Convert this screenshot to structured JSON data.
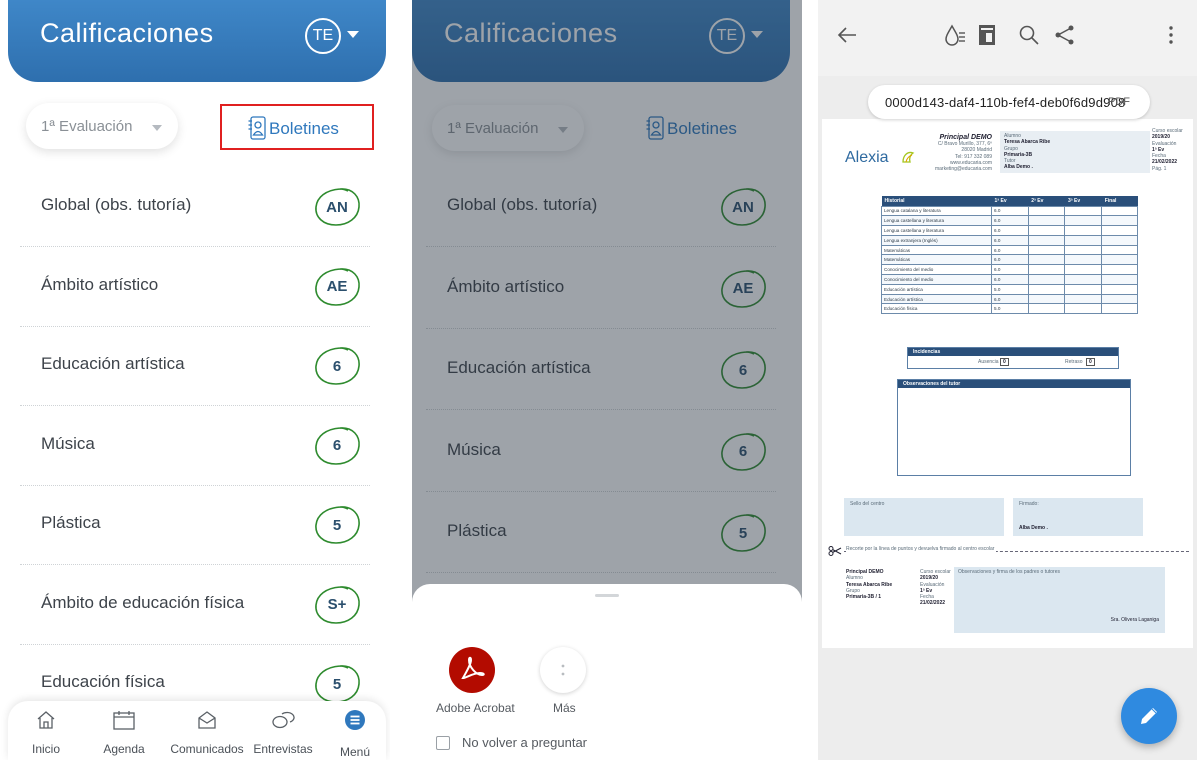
{
  "app": {
    "title": "Calificaciones",
    "avatar_initials": "TE",
    "evaluation": "1ª Evaluación",
    "boletines_label": "Boletines"
  },
  "grades": [
    {
      "subject": "Global (obs. tutoría)",
      "grade": "AN"
    },
    {
      "subject": "Ámbito artístico",
      "grade": "AE"
    },
    {
      "subject": "Educación artística",
      "grade": "6"
    },
    {
      "subject": "Música",
      "grade": "6"
    },
    {
      "subject": "Plástica",
      "grade": "5"
    },
    {
      "subject": "Ámbito de educación física",
      "grade": "S+"
    },
    {
      "subject": "Educación física",
      "grade": "5"
    }
  ],
  "bottom_nav": [
    "Inicio",
    "Agenda",
    "Comunicados",
    "Entrevistas",
    "Menú"
  ],
  "share_sheet": {
    "apps": [
      "Adobe Acrobat",
      "Más"
    ],
    "checkbox_label": "No volver a preguntar"
  },
  "pdf_viewer": {
    "file_name": "0000d143-daf4-110b-fef4-deb0f6d9d908",
    "file_ext": "PDF",
    "brand": "Alexia",
    "school": {
      "name": "Principal DEMO",
      "address": "C/ Bravo Murillo, 377, 6º",
      "city": "28020 Madrid",
      "tel": "Tel: 917 332 089",
      "web": "www.educaria.com",
      "email": "marketing@educaria.com"
    },
    "meta_labels": [
      "Alumno",
      "Grupo",
      "Tutor"
    ],
    "meta_values": [
      "Teresa Abarca Ribe",
      "Primaria-3B",
      "Alba Demo ."
    ],
    "course_labels": [
      "Curso escolar",
      "Evaluación",
      "Fecha"
    ],
    "course_values": [
      "2019/20",
      "1ª Ev",
      "21/02/2022"
    ],
    "page": "Pág. 1",
    "history_headers": [
      "Historial",
      "1ª Ev",
      "2ª Ev",
      "3ª Ev",
      "Final"
    ],
    "history_rows": [
      [
        "Lengua catalana y literatura",
        "6.0"
      ],
      [
        "Lengua castellana y literatura",
        "6.0"
      ],
      [
        "Lengua castellana y literatura",
        "6.0"
      ],
      [
        "Lengua extranjera (Inglés)",
        "6.0"
      ],
      [
        "Matemáticas",
        "6.0"
      ],
      [
        "Matemáticas",
        "6.0"
      ],
      [
        "Conocimiento del medio",
        "6.0"
      ],
      [
        "Conocimiento del medio",
        "6.0"
      ],
      [
        "Educación artística",
        "5.0"
      ],
      [
        "Educación artística",
        "6.0"
      ],
      [
        "Educación física",
        "5.0"
      ]
    ],
    "incidencias": {
      "title": "Incidencias",
      "ausencia_label": "Ausencia",
      "ausencia": "0",
      "retraso_label": "Retraso",
      "retraso": "0"
    },
    "observaciones_title": "Observaciones del tutor",
    "sello_label": "Sello del centro",
    "firmado_label": "Firmado:",
    "firmado_name": "Alba Demo .",
    "cut_text": "Recorte por la línea de puntos y devuelva firmado al centro escolar",
    "stub": {
      "school": "Principal DEMO",
      "student_label": "Alumno",
      "student": "Teresa Abarca Ribe",
      "group_label": "Grupo",
      "group": "Primaria-3B / 1",
      "course_label": "Curso escolar",
      "course": "2019/20",
      "eval_label": "Evaluación",
      "eval": "1ª Ev",
      "date_label": "Fecha",
      "date": "21/02/2022",
      "obs_label": "Observaciones y firma de los padres o tutores",
      "signer": "Sra. Olivera Laganiga"
    }
  },
  "colors": {
    "header_blue": "#3a80c2",
    "highlight_red": "#e02020",
    "grade_ring": "#2e8b2e",
    "acrobat_red": "#b30b00",
    "fab_blue": "#2f8ae0"
  }
}
